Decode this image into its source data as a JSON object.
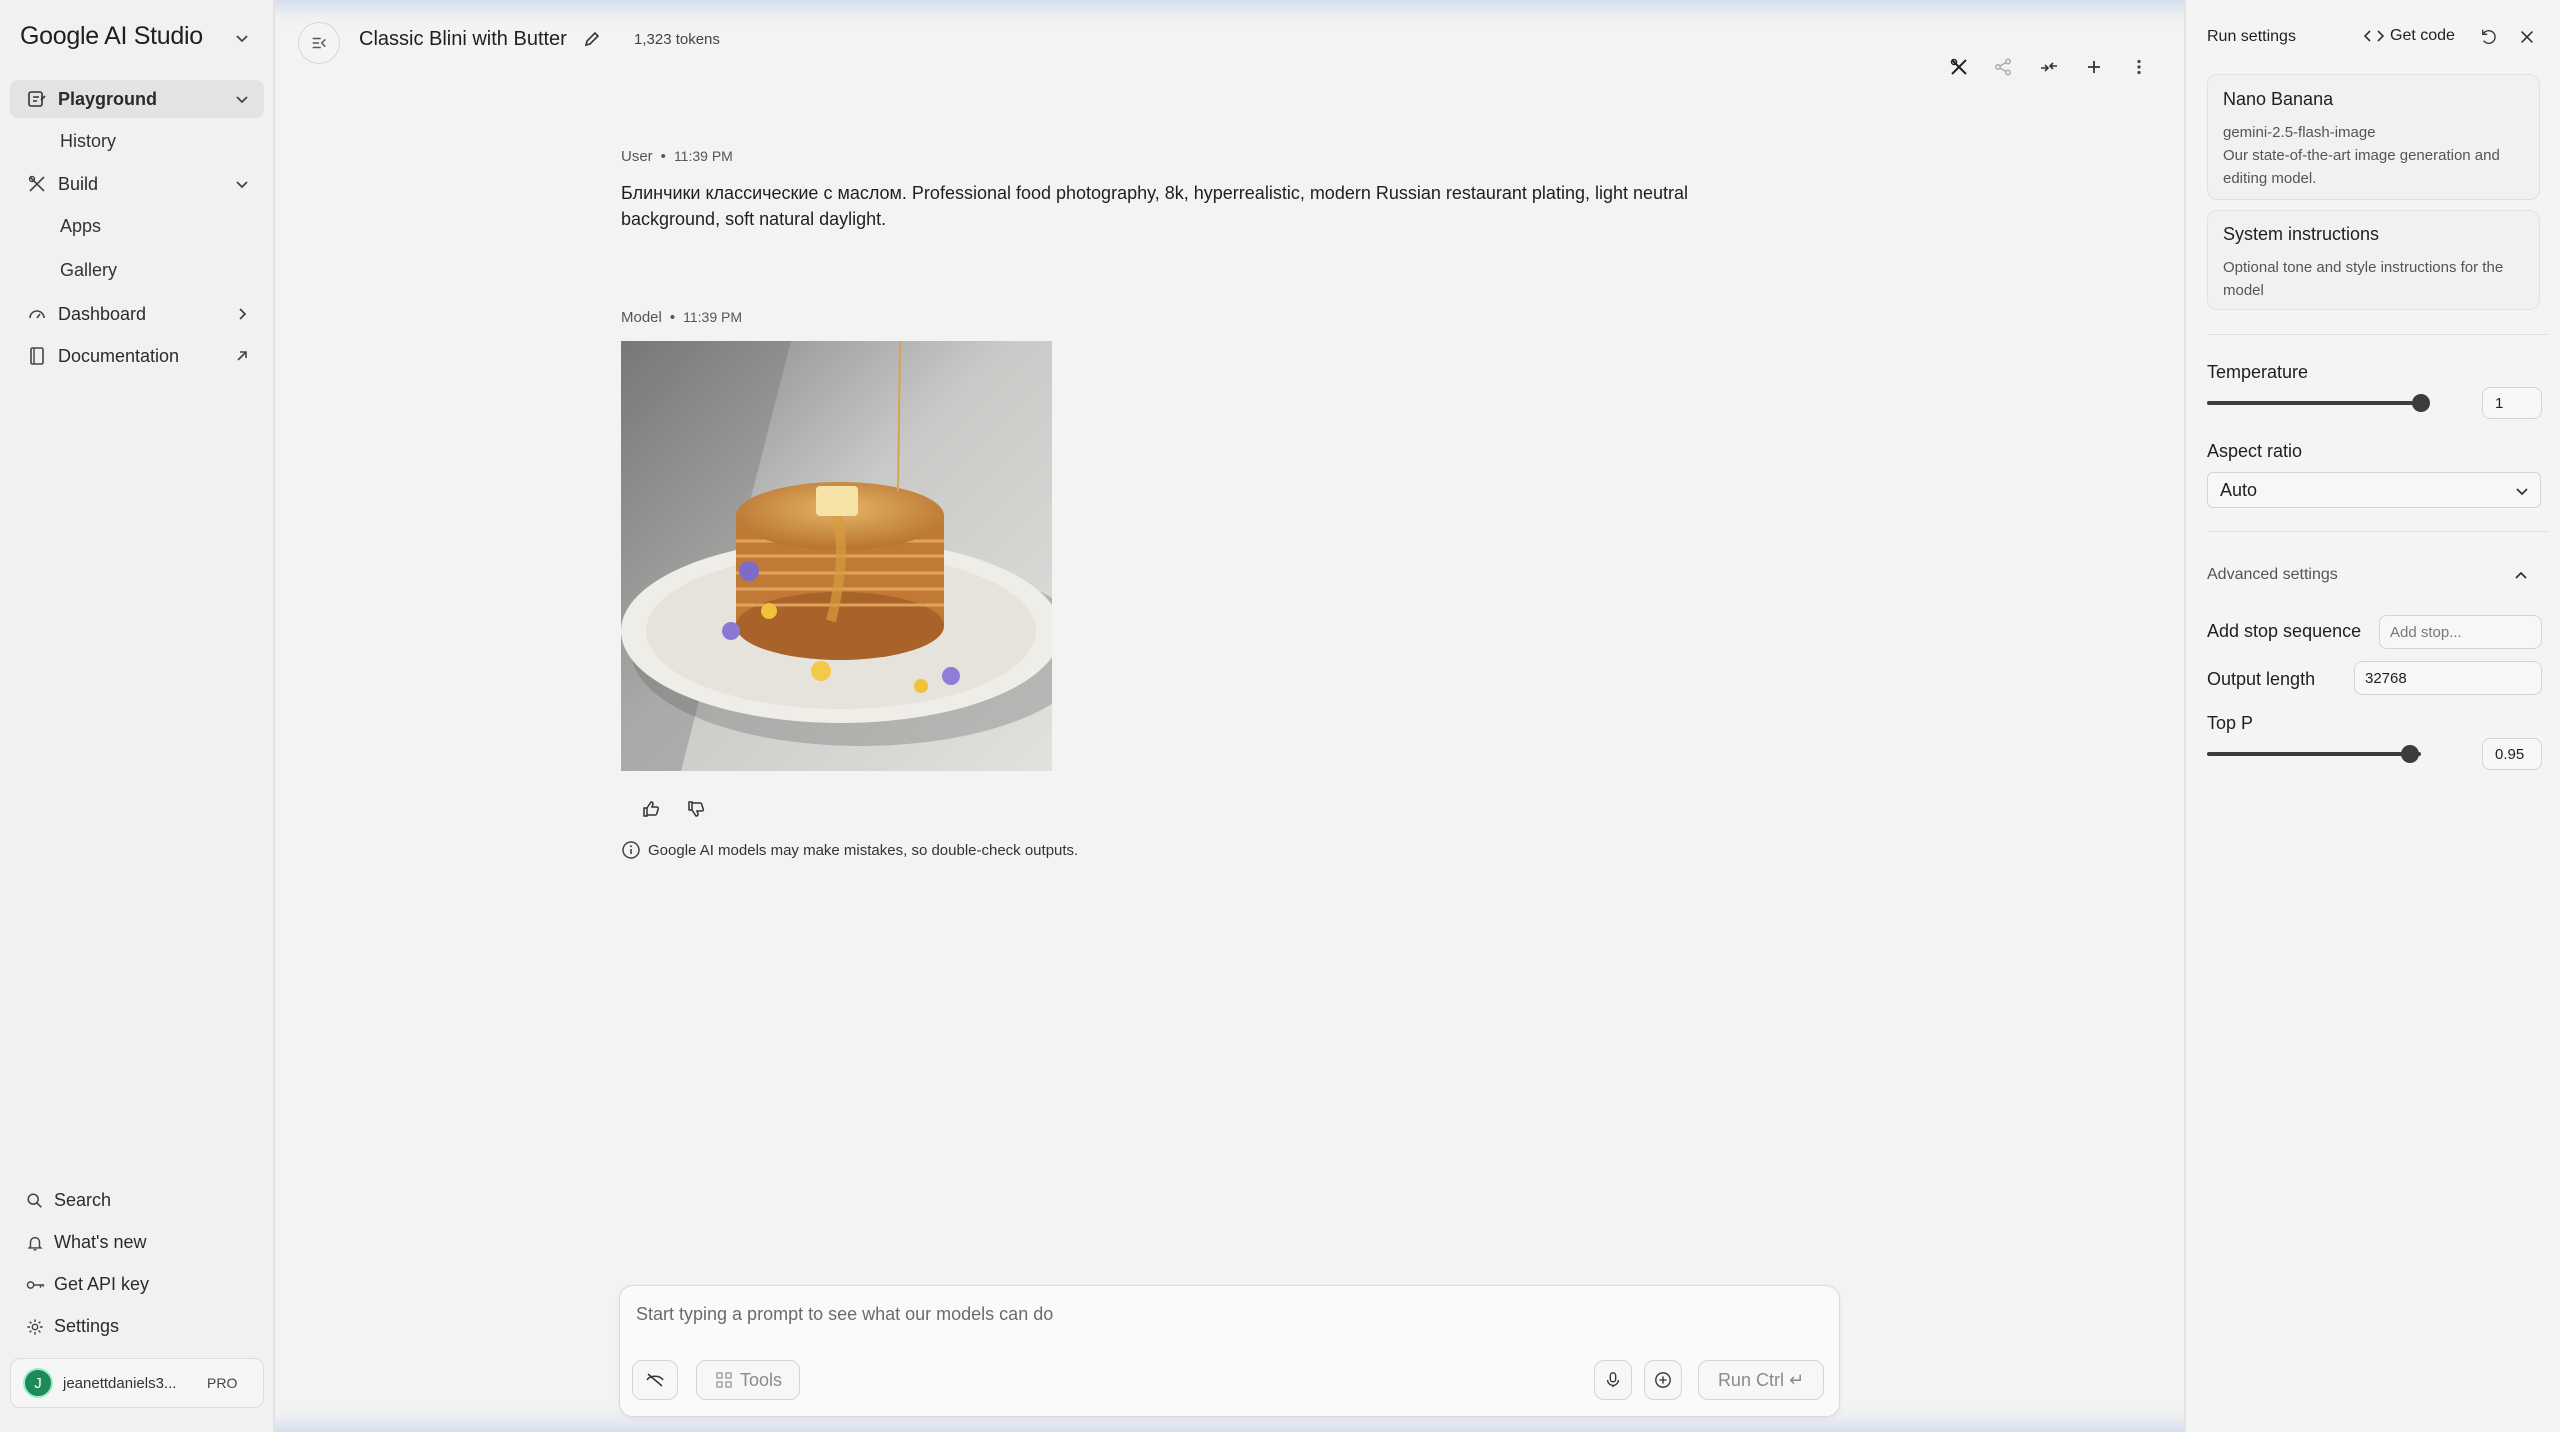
{
  "sidebar": {
    "brand": "Google AI Studio",
    "nav": {
      "playground": "Playground",
      "history": "History",
      "build": "Build",
      "apps": "Apps",
      "gallery": "Gallery",
      "dashboard": "Dashboard",
      "documentation": "Documentation"
    },
    "bottom": {
      "search": "Search",
      "whats_new": "What's new",
      "api_key": "Get API key",
      "settings": "Settings"
    },
    "user": {
      "initial": "J",
      "email": "jeanettdaniels3...",
      "plan": "PRO"
    }
  },
  "topbar": {
    "title": "Classic Blini with Butter",
    "tokens": "1,323 tokens"
  },
  "chat": {
    "user_turn": {
      "role": "User",
      "time": "11:39 PM",
      "text": "Блинчики классические с маслом. Professional food photography, 8k, hyperrealistic, modern Russian restaurant plating, light neutral background, soft natural daylight."
    },
    "model_turn": {
      "role": "Model",
      "time": "11:39 PM"
    },
    "disclaimer": "Google AI models may make mistakes, so double-check outputs."
  },
  "composer": {
    "placeholder": "Start typing a prompt to see what our models can do",
    "tools_label": "Tools",
    "run_label": "Run Ctrl ↵"
  },
  "run_settings": {
    "title": "Run settings",
    "get_code": "Get code",
    "model": {
      "name": "Nano Banana",
      "id": "gemini-2.5-flash-image",
      "description": "Our state-of-the-art image generation and editing model."
    },
    "system_instructions": {
      "title": "System instructions",
      "description": "Optional tone and style instructions for the model"
    },
    "temperature": {
      "label": "Temperature",
      "value": "1",
      "fraction": 1.0
    },
    "aspect_ratio": {
      "label": "Aspect ratio",
      "value": "Auto"
    },
    "advanced": {
      "label": "Advanced settings",
      "stop_sequence": {
        "label": "Add stop sequence",
        "placeholder": "Add stop..."
      },
      "output_length": {
        "label": "Output length",
        "value": "32768"
      },
      "top_p": {
        "label": "Top P",
        "value": "0.95",
        "fraction": 0.95
      }
    }
  }
}
